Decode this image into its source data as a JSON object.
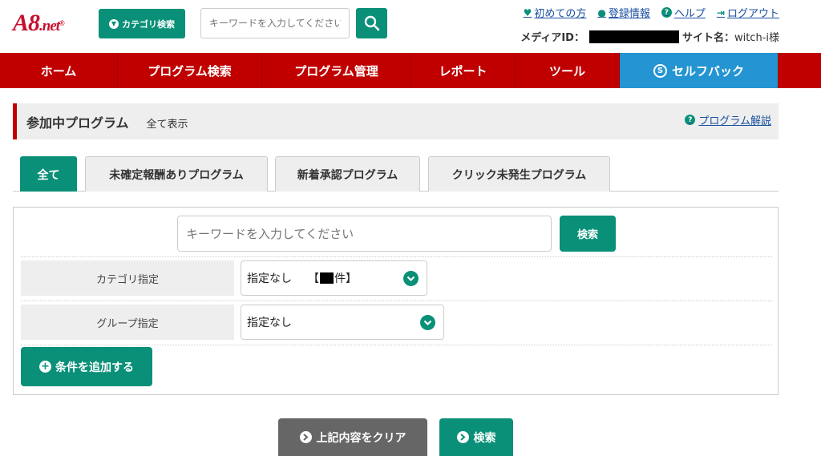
{
  "header": {
    "logo_main": "A8",
    "logo_net": ".net",
    "logo_reg": "®",
    "category_search_label": "カテゴリ検索",
    "keyword_placeholder": "キーワードを入力してください",
    "links": [
      {
        "label": "初めての方",
        "icon": "beginner-mark-icon"
      },
      {
        "label": "登録情報",
        "icon": "person-icon"
      },
      {
        "label": "ヘルプ",
        "icon": "help-icon"
      },
      {
        "label": "ログアウト",
        "icon": "logout-icon"
      }
    ],
    "media_id_label": "メディアID：",
    "site_name_label": "サイト名：",
    "site_name_value": "witch-i様"
  },
  "nav": {
    "items": [
      {
        "label": "ホーム"
      },
      {
        "label": "プログラム検索"
      },
      {
        "label": "プログラム管理"
      },
      {
        "label": "レポート"
      },
      {
        "label": "ツール"
      },
      {
        "label": "セルフバック",
        "icon": "selfback-icon"
      }
    ]
  },
  "title_bar": {
    "title": "参加中プログラム",
    "subtitle": "全て表示",
    "help_link": "プログラム解説"
  },
  "tabs": [
    {
      "label": "全て",
      "active": true
    },
    {
      "label": "未確定報酬ありプログラム",
      "active": false
    },
    {
      "label": "新着承認プログラム",
      "active": false
    },
    {
      "label": "クリック未発生プログラム",
      "active": false
    }
  ],
  "search_panel": {
    "keyword_placeholder": "キーワードを入力してください",
    "search_button": "検索",
    "category": {
      "label": "カテゴリ指定",
      "value": "指定なし",
      "count_prefix": "【",
      "count_suffix": "件】"
    },
    "group": {
      "label": "グループ指定",
      "value": "指定なし"
    },
    "add_condition_button": "条件を追加する"
  },
  "bottom": {
    "clear_button": "上記内容をクリア",
    "search_button": "検索"
  },
  "colors": {
    "brand_red": "#c00000",
    "accent_green": "#0a9078",
    "selfback_blue": "#2494d2",
    "link_blue": "#1a4fa0"
  }
}
